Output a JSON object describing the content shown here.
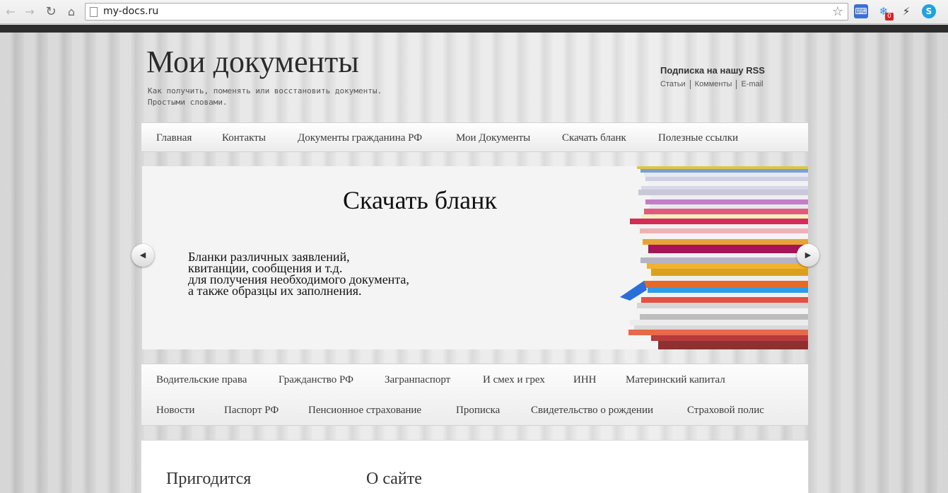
{
  "browser": {
    "url": "my-docs.ru",
    "nav_icons": [
      "back-icon",
      "forward-icon",
      "reload-icon",
      "home-icon"
    ],
    "badge_count": "0"
  },
  "site": {
    "title": "Мои документы",
    "description_line1": "Как получить, поменять или восстановить документы.",
    "description_line2": "Простыми словами."
  },
  "rss": {
    "title": "Подписка на нашу RSS",
    "links": [
      "Статьи",
      "Комменты",
      "E-mail"
    ]
  },
  "main_nav": [
    "Главная",
    "Контакты",
    "Документы гражданина РФ",
    "Мои Документы",
    "Скачать бланк",
    "Полезные ссылки"
  ],
  "slider": {
    "title": "Скачать бланк",
    "lines": [
      "Бланки различных заявлений,",
      "квитанции, сообщения и т.д.",
      "для получения необходимого документа,",
      "а также образцы их заполнения."
    ]
  },
  "categories": {
    "row1": [
      "Водительские права",
      "Гражданство РФ",
      "Загранпаспорт",
      "И смех и грех",
      "ИНН",
      "Материнский капитал"
    ],
    "row2": [
      "Новости",
      "Паспорт РФ",
      "Пенсионное страхование",
      "Прописка",
      "Свидетельство о рождении",
      "Страховой полис"
    ]
  },
  "widgets": {
    "left_title": "Пригодится",
    "right_title": "О сайте"
  }
}
